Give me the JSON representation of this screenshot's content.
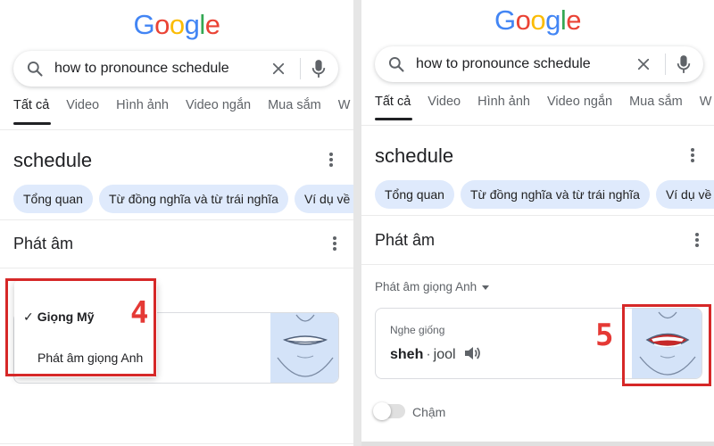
{
  "google_logo": {
    "letters": [
      "G",
      "o",
      "o",
      "g",
      "l",
      "e"
    ]
  },
  "search": {
    "query": "how to pronounce schedule"
  },
  "tabs": [
    "Tất cả",
    "Video",
    "Hình ảnh",
    "Video ngắn",
    "Mua sắm",
    "W"
  ],
  "word": "schedule",
  "chips": [
    "Tổng quan",
    "Từ đồng nghĩa và từ trái nghĩa",
    "Ví dụ về c"
  ],
  "pronunciation_heading": "Phát âm",
  "left": {
    "dropdown": {
      "checkmark": "✓",
      "selected": "Giọng Mỹ",
      "option": "Phát âm giọng Anh"
    },
    "step": "4"
  },
  "right": {
    "accent_select": "Phát âm giọng Anh",
    "sounds_like_label": "Nghe giống",
    "phonetic_stressed": "sheh",
    "phonetic_separator": "·",
    "phonetic_rest": "jool",
    "step": "5",
    "slow_label": "Chậm"
  },
  "colors": {
    "annotation_red": "#d62828",
    "chip_bg": "#dfeafc",
    "mouth_bg": "#d4e3f8"
  },
  "icons": [
    "search-icon",
    "clear-icon",
    "mic-icon",
    "more-vert-icon",
    "speaker-icon",
    "checkmark-icon",
    "dropdown-caret-icon"
  ]
}
